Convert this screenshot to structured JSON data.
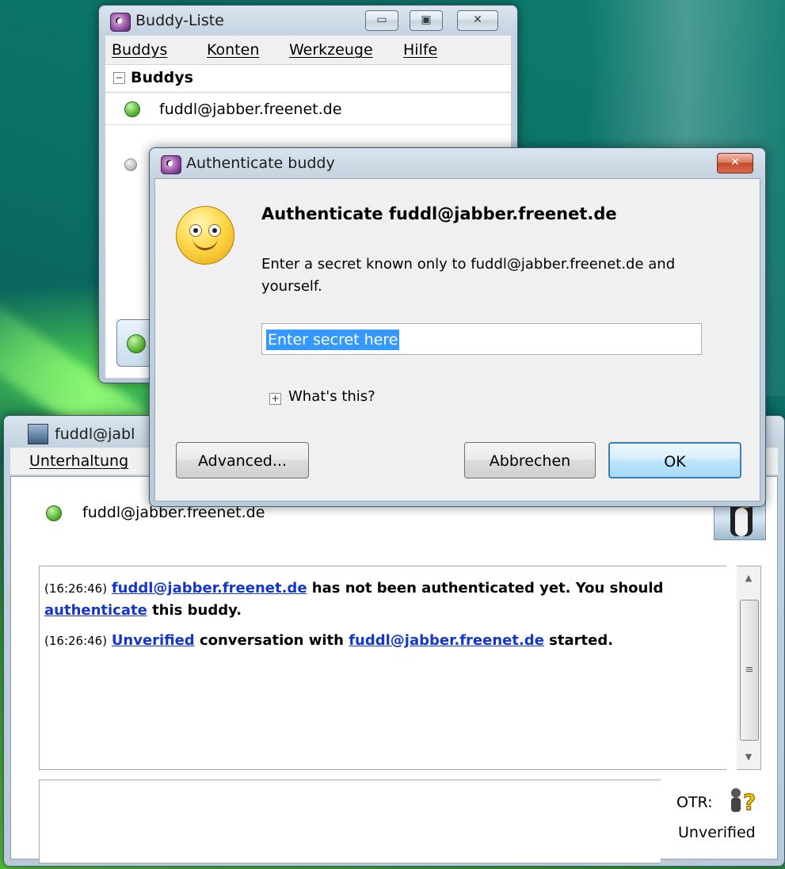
{
  "buddy_list": {
    "title": "Buddy-Liste",
    "menu": [
      "Buddys",
      "Konten",
      "Werkzeuge",
      "Hilfe"
    ],
    "group": "Buddys",
    "buddy": "fuddl@jabber.freenet.de"
  },
  "conversation": {
    "title": "fuddl@jabl",
    "menu": "Unterhaltung",
    "buddy": "fuddl@jabber.freenet.de",
    "messages": [
      {
        "time": "(16:26:46)",
        "link1": "fuddl@jabber.freenet.de",
        "text1": " has not been authenticated yet.  You should ",
        "link2": "authenticate",
        "text2": " this buddy."
      },
      {
        "time": "(16:26:46)",
        "link1": "Unverified",
        "text1": " conversation with ",
        "link2": "fuddl@jabber.freenet.de",
        "text2": " started."
      }
    ],
    "otr_label": "OTR:",
    "otr_status": "Unverified"
  },
  "auth_dialog": {
    "title": "Authenticate buddy",
    "heading": "Authenticate fuddl@jabber.freenet.de",
    "description": "Enter a secret known only to fuddl@jabber.freenet.de and yourself.",
    "secret_placeholder": "Enter secret here",
    "whats_this": "What's this?",
    "buttons": {
      "advanced": "Advanced...",
      "cancel": "Abbrechen",
      "ok": "OK"
    }
  }
}
